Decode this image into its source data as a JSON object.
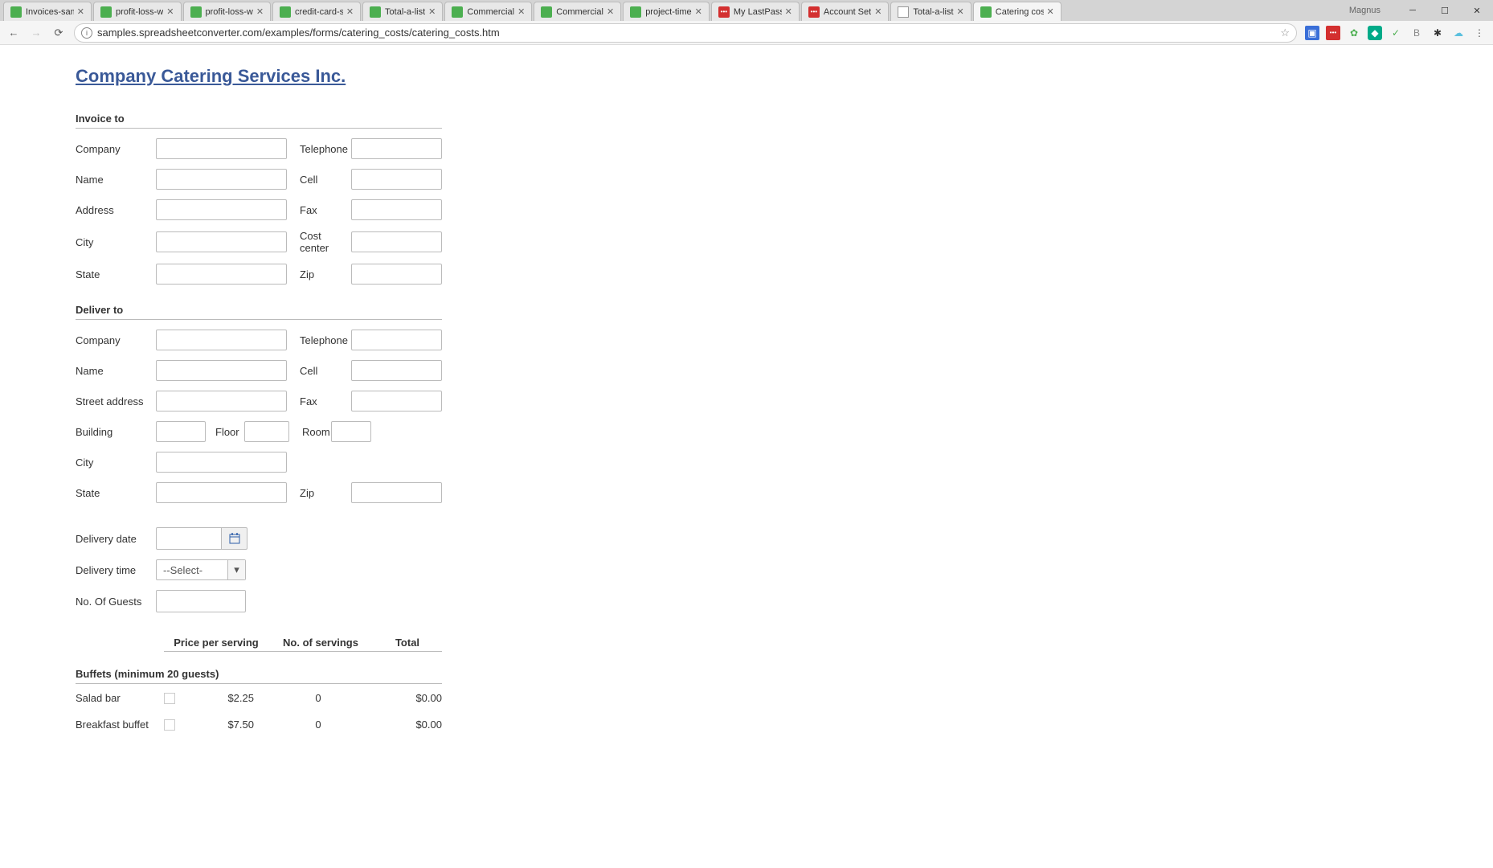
{
  "browser": {
    "profile": "Magnus",
    "url": "samples.spreadsheetconverter.com/examples/forms/catering_costs/catering_costs.htm",
    "tabs": [
      {
        "title": "Invoices-sam",
        "favicon": "green"
      },
      {
        "title": "profit-loss-w",
        "favicon": "green"
      },
      {
        "title": "profit-loss-w",
        "favicon": "green"
      },
      {
        "title": "credit-card-s",
        "favicon": "green"
      },
      {
        "title": "Total-a-list",
        "favicon": "green"
      },
      {
        "title": "Commercial",
        "favicon": "green"
      },
      {
        "title": "Commercial",
        "favicon": "green"
      },
      {
        "title": "project-time",
        "favicon": "green"
      },
      {
        "title": "My LastPass",
        "favicon": "red"
      },
      {
        "title": "Account Set",
        "favicon": "red"
      },
      {
        "title": "Total-a-list",
        "favicon": "doc"
      },
      {
        "title": "Catering cos",
        "favicon": "green",
        "active": true
      }
    ]
  },
  "page": {
    "title": "Company Catering Services Inc.",
    "invoice_header": "Invoice to",
    "deliver_header": "Deliver to",
    "labels": {
      "company": "Company",
      "name": "Name",
      "address": "Address",
      "street_address": "Street address",
      "city": "City",
      "state": "State",
      "telephone": "Telephone",
      "cell": "Cell",
      "fax": "Fax",
      "cost_center": "Cost center",
      "zip": "Zip",
      "building": "Building",
      "floor": "Floor",
      "room": "Room",
      "delivery_date": "Delivery date",
      "delivery_time": "Delivery time",
      "guests": "No. Of Guests"
    },
    "delivery_time_selected": "--Select-",
    "table_headers": {
      "price": "Price per serving",
      "servings": "No. of servings",
      "total": "Total"
    },
    "buffets_header": "Buffets (minimum 20 guests)",
    "items": [
      {
        "name": "Salad bar",
        "price": "$2.25",
        "servings": "0",
        "total": "$0.00"
      },
      {
        "name": "Breakfast buffet",
        "price": "$7.50",
        "servings": "0",
        "total": "$0.00"
      }
    ]
  }
}
